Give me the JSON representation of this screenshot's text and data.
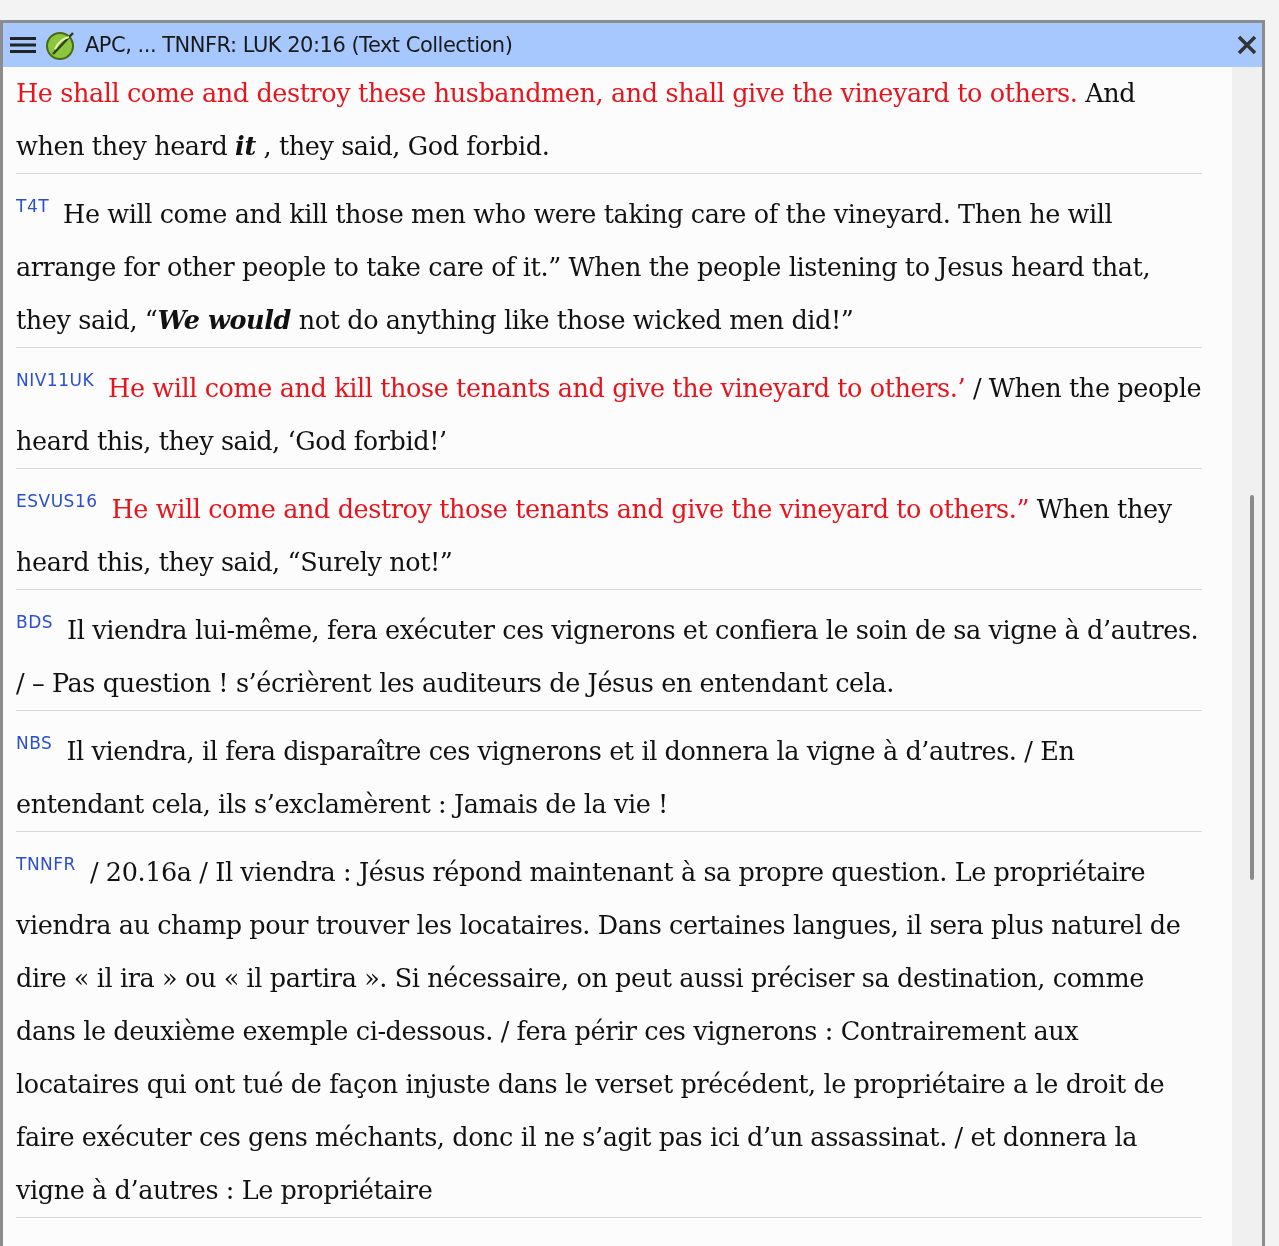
{
  "window": {
    "title": "APC, ... TNNFR: LUK 20:16 (Text Collection)"
  },
  "entries": [
    {
      "segments": [
        {
          "kind": "red",
          "text": "He shall come and destroy these husbandmen, and shall give the vineyard to others."
        },
        {
          "kind": "plain",
          "text": " And when they heard "
        },
        {
          "kind": "emphasis",
          "text": "it"
        },
        {
          "kind": "plain",
          "text": " , they said, God forbid."
        }
      ]
    },
    {
      "version": "T4T",
      "segments": [
        {
          "kind": "plain",
          "text": "He will come and kill those men who were taking care of the vineyard. Then he will arrange for other people to take care of it.” When the people listening to Jesus heard that, they said, “"
        },
        {
          "kind": "emphasis",
          "text": "We would"
        },
        {
          "kind": "plain",
          "text": " not do anything like those wicked men did!”"
        }
      ]
    },
    {
      "version": "NIV11UK",
      "segments": [
        {
          "kind": "red",
          "text": "He will come and kill those tenants and give the vineyard to others.’"
        },
        {
          "kind": "plain",
          "text": " / When the people heard this, they said, ‘God forbid!’"
        }
      ]
    },
    {
      "version": "ESVUS16",
      "segments": [
        {
          "kind": "red",
          "text": "He will come and destroy those tenants and give the vineyard to others.”"
        },
        {
          "kind": "plain",
          "text": " When they heard this, they said, “Surely not!”"
        }
      ]
    },
    {
      "version": "BDS",
      "segments": [
        {
          "kind": "plain",
          "text": "Il viendra lui-même, fera exécuter ces vignerons et confiera le soin de sa vigne à d’autres. / – Pas question ! s’écrièrent les auditeurs de Jésus en entendant cela."
        }
      ]
    },
    {
      "version": "NBS",
      "segments": [
        {
          "kind": "plain",
          "text": "Il viendra, il fera disparaître ces vignerons et il donnera la vigne à d’autres. / En entendant cela, ils s’exclamèrent : Jamais de la vie !"
        }
      ]
    },
    {
      "version": "TNNFR",
      "segments": [
        {
          "kind": "plain",
          "text": "/ 20.16a / Il viendra : Jésus répond maintenant à sa propre question. Le propriétaire viendra au champ pour trouver les locataires. Dans certaines langues, il sera plus naturel de dire « il ira » ou « il partira ». Si nécessaire, on peut aussi préciser sa destination, comme dans le deuxième exemple ci-dessous. / fera périr ces vignerons : Contrairement aux locataires qui ont tué de façon injuste dans le verset précédent, le propriétaire a le droit de faire exécuter ces gens méchants, donc il ne s’agit pas ici d’un assassinat. / et donnera la vigne à d’autres : Le propriétaire"
        }
      ]
    }
  ]
}
